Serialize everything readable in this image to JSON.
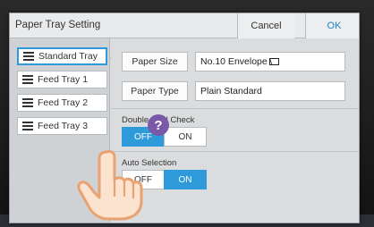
{
  "dialog": {
    "title": "Paper Tray Setting",
    "cancel_label": "Cancel",
    "ok_label": "OK"
  },
  "trays": [
    {
      "label": "Standard Tray",
      "selected": true,
      "icon": "tray-icon"
    },
    {
      "label": "Feed Tray 1",
      "selected": false,
      "icon": "tray-icon"
    },
    {
      "label": "Feed Tray 2",
      "selected": false,
      "icon": "tray-icon"
    },
    {
      "label": "Feed Tray 3",
      "selected": false,
      "icon": "tray-icon"
    }
  ],
  "settings": {
    "paper_size_label": "Paper Size",
    "paper_size_value": "No.10 Envelope",
    "paper_type_label": "Paper Type",
    "paper_type_value": "Plain Standard",
    "double_feed": {
      "label": "Double-feed Check",
      "off_label": "OFF",
      "on_label": "ON",
      "selected": "OFF"
    },
    "help_label": "?",
    "auto_selection": {
      "label": "Auto Selection",
      "off_label": "OFF",
      "on_label": "ON",
      "selected": "ON"
    }
  },
  "colors": {
    "accent": "#2e9ad9",
    "ok_text": "#1a84c5",
    "help_bg": "#7a59a8",
    "dialog_bg": "#d7d9da"
  }
}
